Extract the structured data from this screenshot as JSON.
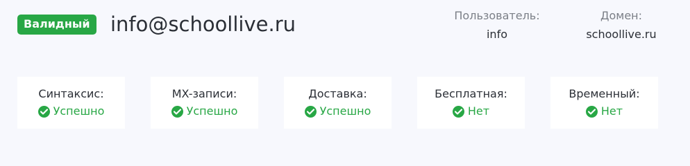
{
  "header": {
    "badge": "Валидный",
    "email": "info@schoollive.ru",
    "user_label": "Пользователь:",
    "user_value": "info",
    "domain_label": "Домен:",
    "domain_value": "schoollive.ru"
  },
  "checks": [
    {
      "title": "Синтаксис:",
      "status": "Успешно",
      "icon": "check-circle-icon"
    },
    {
      "title": "MX-записи:",
      "status": "Успешно",
      "icon": "check-circle-icon"
    },
    {
      "title": "Доставка:",
      "status": "Успешно",
      "icon": "check-circle-icon"
    },
    {
      "title": "Бесплатная:",
      "status": "Нет",
      "icon": "check-circle-icon"
    },
    {
      "title": "Временный:",
      "status": "Нет",
      "icon": "check-circle-icon"
    }
  ],
  "colors": {
    "accent": "#28a745",
    "background": "#f7f8fd",
    "card": "#ffffff"
  }
}
